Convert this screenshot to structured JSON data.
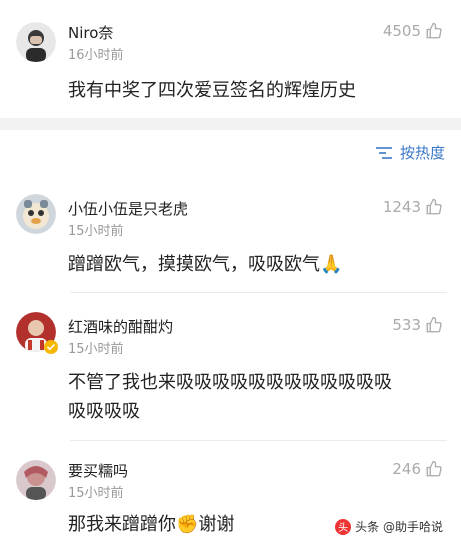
{
  "top_post": {
    "username": "Niro奈",
    "time": "16小时前",
    "likes": "4505",
    "text": "我有中奖了四次爱豆签名的辉煌历史"
  },
  "sort": {
    "label": "按热度"
  },
  "comments": [
    {
      "username": "小伍小伍是只老虎",
      "time": "15小时前",
      "likes": "1243",
      "text": "蹭蹭欧气，摸摸欧气，吸吸欧气🙏"
    },
    {
      "username": "红酒味的酣酣灼",
      "time": "15小时前",
      "likes": "533",
      "text_line1": "不管了我也来吸吸吸吸吸吸吸吸吸吸吸吸",
      "text_line2": "吸吸吸吸"
    },
    {
      "username": "要买糯吗",
      "time": "15小时前",
      "likes": "246",
      "text": "那我来蹭蹭你✊谢谢"
    }
  ],
  "watermark": {
    "text": "头条 @助手哈说"
  },
  "colors": {
    "accent": "#3b78c8",
    "muted": "#999999",
    "separator": "#f2f2f2"
  },
  "icons": [
    "thumbs-up-icon",
    "sort-icon",
    "verified-badge-icon"
  ]
}
